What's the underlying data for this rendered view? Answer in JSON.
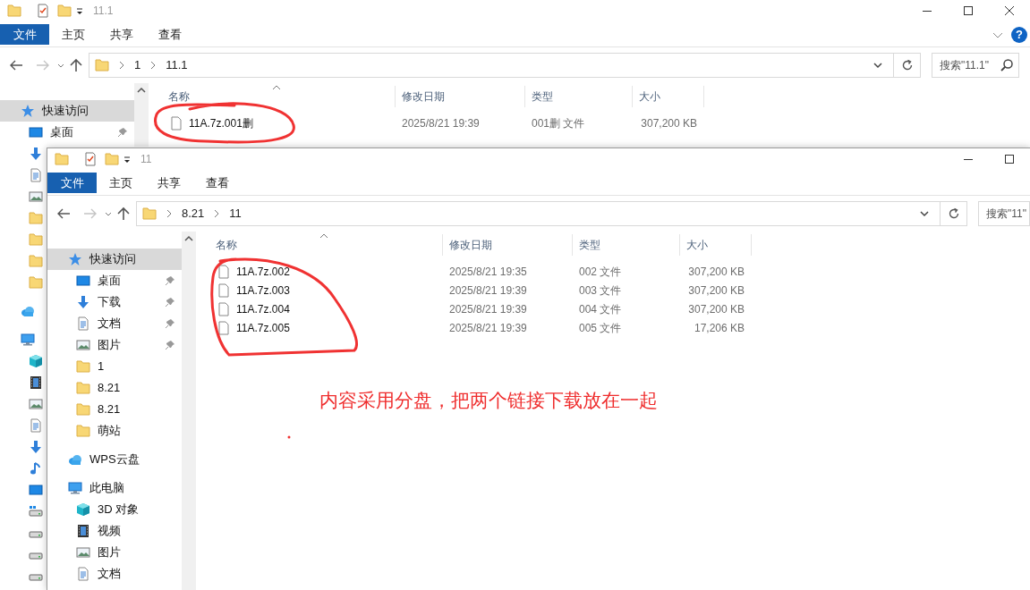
{
  "windows": [
    {
      "title": "11.1",
      "controls": [
        {
          "kind": "minimize"
        },
        {
          "kind": "maximize"
        },
        {
          "kind": "close"
        }
      ],
      "ribbon": {
        "tabs": [
          {
            "label": "文件",
            "selected": true
          },
          {
            "label": "主页",
            "selected": false
          },
          {
            "label": "共享",
            "selected": false
          },
          {
            "label": "查看",
            "selected": false
          }
        ],
        "help": "?"
      },
      "address": {
        "path": [
          "1",
          "11.1"
        ],
        "search_placeholder": "搜索\"11.1\""
      },
      "sidebar": [
        {
          "kind": "star",
          "label": "快速访问",
          "selected": true,
          "children": [
            {
              "kind": "desktop",
              "label": "桌面",
              "selected": false,
              "pinned": true
            },
            {
              "kind": "download",
              "selected": false
            },
            {
              "kind": "document",
              "selected": false
            },
            {
              "kind": "pictures",
              "selected": false
            },
            {
              "kind": "folder",
              "selected": false
            },
            {
              "kind": "folder",
              "selected": false
            },
            {
              "kind": "folder",
              "selected": false
            },
            {
              "kind": "folder",
              "selected": false
            }
          ]
        },
        {
          "kind": "cloud",
          "selected": false
        },
        {
          "kind": "pc",
          "selected": false,
          "children": [
            {
              "kind": "cube",
              "selected": false
            },
            {
              "kind": "video",
              "selected": false
            },
            {
              "kind": "pictures",
              "selected": false
            },
            {
              "kind": "document",
              "selected": false
            },
            {
              "kind": "download",
              "selected": false
            },
            {
              "kind": "music",
              "selected": false
            },
            {
              "kind": "desktop",
              "selected": false
            },
            {
              "kind": "drive_win",
              "selected": false
            },
            {
              "kind": "drive",
              "selected": false
            },
            {
              "kind": "drive",
              "selected": false
            },
            {
              "kind": "drive",
              "selected": false
            }
          ]
        }
      ],
      "columns": [
        {
          "label": "名称",
          "sorted": true
        },
        {
          "label": "修改日期",
          "sorted": false
        },
        {
          "label": "类型",
          "sorted": false
        },
        {
          "label": "大小",
          "sorted": false
        }
      ],
      "files": [
        {
          "name": "11A.7z.001删",
          "modified": "2025/8/21 19:39",
          "type": "001删 文件",
          "size": "307,200 KB"
        }
      ]
    },
    {
      "title": "11",
      "controls": [
        {
          "kind": "minimize"
        },
        {
          "kind": "maximize"
        }
      ],
      "ribbon": {
        "tabs": [
          {
            "label": "文件",
            "selected": true
          },
          {
            "label": "主页",
            "selected": false
          },
          {
            "label": "共享",
            "selected": false
          },
          {
            "label": "查看",
            "selected": false
          }
        ]
      },
      "address": {
        "path": [
          "8.21",
          "11"
        ],
        "search_placeholder": "搜索\"11\""
      },
      "sidebar": [
        {
          "kind": "star",
          "label": "快速访问",
          "selected": true,
          "children": [
            {
              "kind": "desktop",
              "label": "桌面",
              "selected": false,
              "pinned": true
            },
            {
              "kind": "download",
              "label": "下载",
              "selected": false,
              "pinned": true
            },
            {
              "kind": "document",
              "label": "文档",
              "selected": false,
              "pinned": true
            },
            {
              "kind": "pictures",
              "label": "图片",
              "selected": false,
              "pinned": true
            },
            {
              "kind": "folder",
              "label": "1",
              "selected": false,
              "pinned": false
            },
            {
              "kind": "folder",
              "label": "8.21",
              "selected": false,
              "pinned": false
            },
            {
              "kind": "folder",
              "label": "8.21",
              "selected": false,
              "pinned": false
            },
            {
              "kind": "folder",
              "label": "萌站",
              "selected": false,
              "pinned": false
            }
          ]
        },
        {
          "kind": "cloud",
          "label": "WPS云盘",
          "selected": false
        },
        {
          "kind": "pc",
          "label": "此电脑",
          "selected": false,
          "children": [
            {
              "kind": "cube",
              "label": "3D 对象",
              "selected": false
            },
            {
              "kind": "video",
              "label": "视频",
              "selected": false
            },
            {
              "kind": "pictures",
              "label": "图片",
              "selected": false
            },
            {
              "kind": "document",
              "label": "文档",
              "selected": false
            }
          ]
        }
      ],
      "columns": [
        {
          "label": "名称",
          "sorted": true
        },
        {
          "label": "修改日期",
          "sorted": false
        },
        {
          "label": "类型",
          "sorted": false
        },
        {
          "label": "大小",
          "sorted": false
        }
      ],
      "files": [
        {
          "name": "11A.7z.002",
          "modified": "2025/8/21 19:35",
          "type": "002 文件",
          "size": "307,200 KB"
        },
        {
          "name": "11A.7z.003",
          "modified": "2025/8/21 19:39",
          "type": "003 文件",
          "size": "307,200 KB"
        },
        {
          "name": "11A.7z.004",
          "modified": "2025/8/21 19:39",
          "type": "004 文件",
          "size": "307,200 KB"
        },
        {
          "name": "11A.7z.005",
          "modified": "2025/8/21 19:39",
          "type": "005 文件",
          "size": "17,206 KB"
        }
      ]
    }
  ],
  "annotation": "内容采用分盘，把两个链接下载放在一起"
}
